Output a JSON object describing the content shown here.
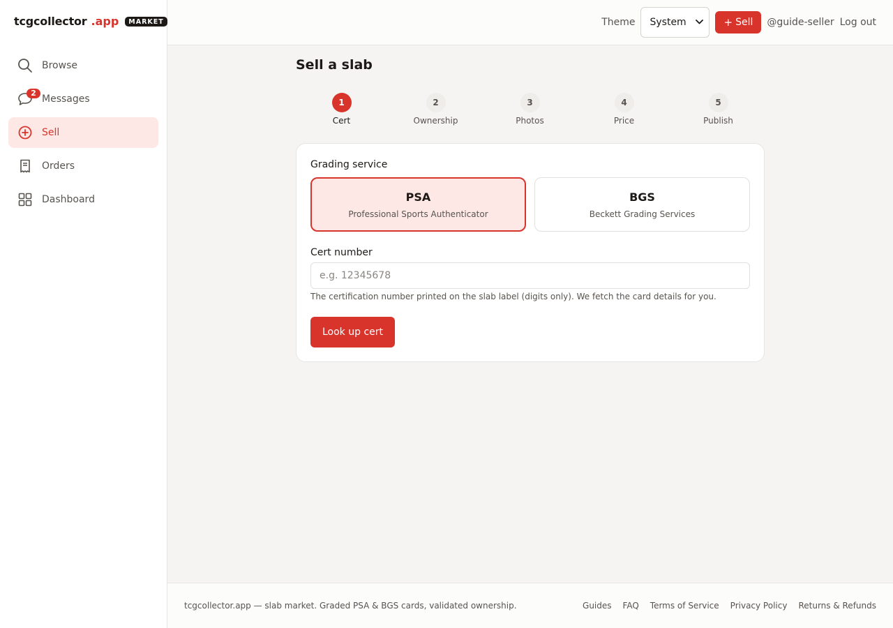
{
  "brand": {
    "name": "tcgcollector",
    "tld": ".app",
    "badge": "MARKET"
  },
  "sidebar": {
    "items": [
      {
        "label": "Browse",
        "icon": "search-icon"
      },
      {
        "label": "Messages",
        "icon": "chat-bubble-icon",
        "badge": "2"
      },
      {
        "label": "Sell",
        "icon": "plus-circle-icon",
        "active": true
      },
      {
        "label": "Orders",
        "icon": "receipt-icon"
      },
      {
        "label": "Dashboard",
        "icon": "grid-icon"
      }
    ]
  },
  "header": {
    "theme_label": "Theme",
    "theme_value": "System",
    "sell_label": "Sell",
    "user_handle": "@guide-seller",
    "logout_label": "Log out"
  },
  "page": {
    "title": "Sell a slab",
    "steps": [
      {
        "num": "1",
        "label": "Cert"
      },
      {
        "num": "2",
        "label": "Ownership"
      },
      {
        "num": "3",
        "label": "Photos"
      },
      {
        "num": "4",
        "label": "Price"
      },
      {
        "num": "5",
        "label": "Publish"
      }
    ],
    "current_step": 1
  },
  "form": {
    "grading_label": "Grading service",
    "services": [
      {
        "code": "PSA",
        "name": "Professional Sports Authenticator",
        "selected": true
      },
      {
        "code": "BGS",
        "name": "Beckett Grading Services",
        "selected": false
      }
    ],
    "cert_label": "Cert number",
    "cert_placeholder": "e.g. 12345678",
    "cert_value": "",
    "cert_help": "The certification number printed on the slab label (digits only). We fetch the card details for you.",
    "submit_label": "Look up cert"
  },
  "footer": {
    "text": "tcgcollector.app — slab market. Graded PSA & BGS cards, validated ownership.",
    "links": [
      "Guides",
      "FAQ",
      "Terms of Service",
      "Privacy Policy",
      "Returns & Refunds"
    ]
  },
  "colors": {
    "accent": "#d9342b",
    "accent_soft": "#fde8e6",
    "text": "#1c1917",
    "muted": "#57534e"
  }
}
